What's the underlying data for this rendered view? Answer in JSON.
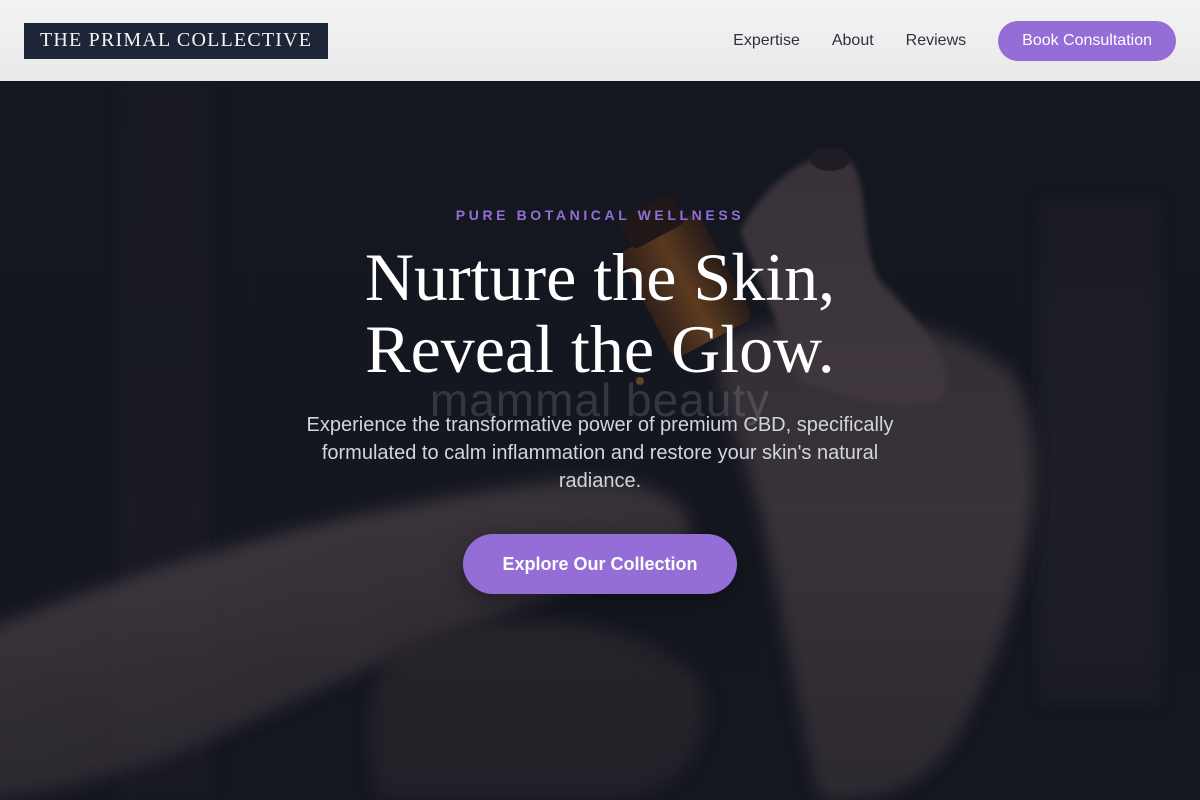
{
  "header": {
    "logo": "THE PRIMAL COLLECTIVE",
    "nav": [
      {
        "label": "Expertise"
      },
      {
        "label": "About"
      },
      {
        "label": "Reviews"
      }
    ],
    "cta_label": "Book Consultation"
  },
  "hero": {
    "eyebrow": "PURE BOTANICAL WELLNESS",
    "headline_line1": "Nurture the Skin,",
    "headline_line2": "Reveal the Glow.",
    "watermark": "mammal beauty",
    "subtext": "Experience the transformative power of premium CBD, specifically formulated to calm inflammation and restore your skin's natural radiance.",
    "cta_label": "Explore Our Collection"
  },
  "colors": {
    "accent": "#946ed6",
    "logo_bg": "#1c2636",
    "header_bg": "#efeff0",
    "hero_bg": "#14161f"
  }
}
